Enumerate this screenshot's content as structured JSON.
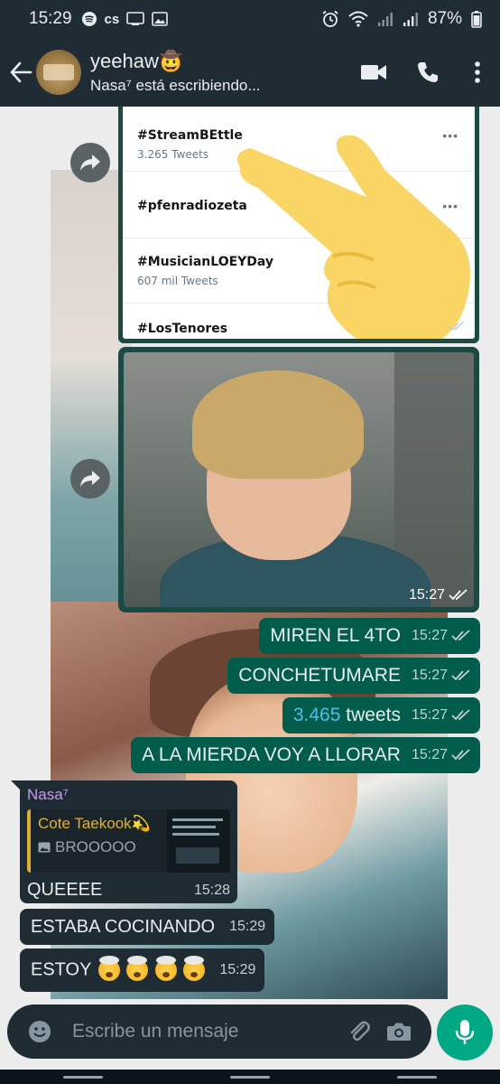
{
  "status_bar": {
    "time": "15:29",
    "battery": "87%",
    "icons": [
      "spotify-icon",
      "cs-icon",
      "cast-icon",
      "gallery-icon",
      "alarm-icon",
      "wifi-icon",
      "signal-icon",
      "signal-icon",
      "battery-icon"
    ],
    "cs_label": "cs"
  },
  "header": {
    "contact_name": "yeehaw🤠",
    "status": "Nasa⁷ está escribiendo..."
  },
  "tweet_screenshot": {
    "trends": [
      {
        "tag": "#StreamBEttle",
        "count": "3.265 Tweets"
      },
      {
        "tag": "#pfenradiozeta",
        "count": ""
      },
      {
        "tag": "#MusicianLOEYDay",
        "count": "607 mil Tweets"
      },
      {
        "tag": "#LosTenores",
        "count": ""
      }
    ],
    "more_label": "•••"
  },
  "photo_message": {
    "time": "15:27"
  },
  "outgoing": [
    {
      "text": "MIREN EL 4TO",
      "time": "15:27"
    },
    {
      "text": "CONCHETUMARE",
      "time": "15:27"
    },
    {
      "number": "3.465",
      "text_after": " tweets",
      "time": "15:27"
    },
    {
      "text": "A LA MIERDA VOY A LLORAR",
      "time": "15:27"
    }
  ],
  "incoming": {
    "sender": "Nasa⁷",
    "quote_author": "Cote Taekook💫",
    "quote_text": "BROOOOO",
    "first": {
      "text": "QUEEEE",
      "time": "15:28"
    },
    "second": {
      "text": "ESTABA COCINANDO",
      "time": "15:29"
    },
    "third": {
      "text": "ESTOY",
      "time": "15:29"
    }
  },
  "composer": {
    "placeholder": "Escribe un mensaje"
  },
  "colors": {
    "header_bg": "#1f2c33",
    "outgoing_bubble": "#005c4b",
    "incoming_bubble": "#1f2c33",
    "accent": "#00a884",
    "sender_name": "#c79ee7",
    "quote_author": "#e0b033",
    "read_ticks": "#c7d1d4",
    "number_highlight": "#53bdeb"
  }
}
